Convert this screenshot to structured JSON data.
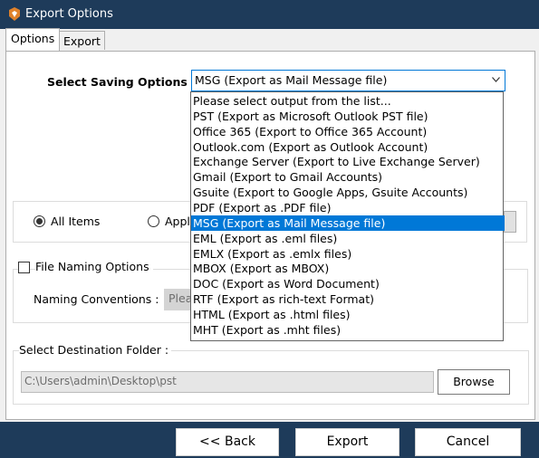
{
  "window": {
    "title": "Export Options"
  },
  "tabs": [
    {
      "label": "Options"
    },
    {
      "label": "Export"
    }
  ],
  "saving": {
    "label": "Select Saving Options :",
    "selected": "MSG (Export as Mail Message file)",
    "options": [
      "Please select output from the list...",
      "PST (Export as Microsoft Outlook PST file)",
      "Office 365 (Export to Office 365 Account)",
      "Outlook.com (Export as Outlook Account)",
      "Exchange Server (Export to Live Exchange Server)",
      "Gmail (Export to Gmail Accounts)",
      "Gsuite (Export to Google Apps, Gsuite Accounts)",
      "PDF (Export as .PDF file)",
      "MSG (Export as Mail Message file)",
      "EML (Export as .eml files)",
      "EMLX (Export as .emlx files)",
      "MBOX (Export as MBOX)",
      "DOC (Export as Word Document)",
      "RTF (Export as rich-text Format)",
      "HTML (Export as .html files)",
      "MHT (Export as .mht files)"
    ],
    "selected_index": 8
  },
  "items": {
    "all_label": "All Items",
    "apply_label": "Apply"
  },
  "naming": {
    "checkbox_label": "File Naming Options",
    "conventions_label": "Naming Conventions :",
    "field_value": "Plea"
  },
  "destination": {
    "label": "Select Destination Folder :",
    "path": "C:\\Users\\admin\\Desktop\\pst",
    "browse_label": "Browse"
  },
  "footer": {
    "back_label": "<< Back",
    "export_label": "Export",
    "cancel_label": "Cancel"
  },
  "colors": {
    "titlebar": "#1e3b5a",
    "selection": "#0078d7",
    "icon": "#e0822b"
  }
}
